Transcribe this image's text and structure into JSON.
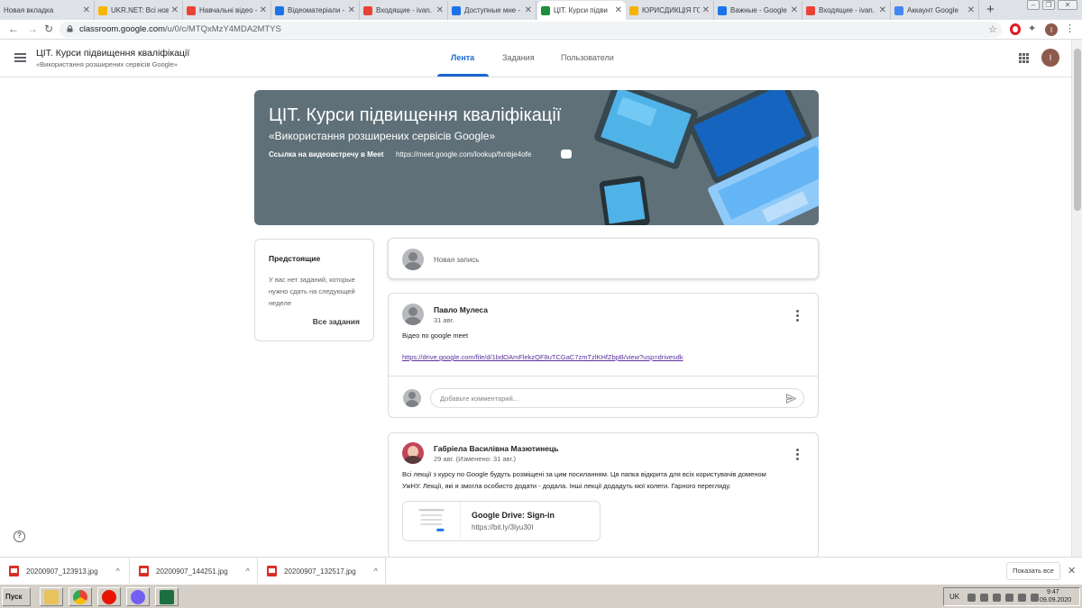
{
  "browser": {
    "tabs": [
      {
        "title": "Новая вкладка",
        "favicon": "blank-icon",
        "color": "#dee1e6"
      },
      {
        "title": "UKR.NET: Всі нови",
        "favicon": "ukrnet-icon",
        "color": "#f9b600"
      },
      {
        "title": "Навчальні відео -",
        "favicon": "gmail-icon",
        "color": "#ea4335"
      },
      {
        "title": "Відеоматеріали -",
        "favicon": "drive-icon",
        "color": "#1a73e8"
      },
      {
        "title": "Входящие - ivan.",
        "favicon": "gmail-icon",
        "color": "#ea4335"
      },
      {
        "title": "Доступные мне -",
        "favicon": "drive-icon",
        "color": "#1a73e8"
      },
      {
        "title": "ЦІТ. Курси підви",
        "favicon": "classroom-icon",
        "color": "#1e8e3e"
      },
      {
        "title": "ЮРИСДИКЦІЯ ГО",
        "favicon": "slides-icon",
        "color": "#f4b400"
      },
      {
        "title": "Важные - Google",
        "favicon": "drive-icon",
        "color": "#1a73e8"
      },
      {
        "title": "Входящие - ivan.",
        "favicon": "gmail-icon",
        "color": "#ea4335"
      },
      {
        "title": "Аккаунт Google",
        "favicon": "google-icon",
        "color": "#4285f4"
      }
    ],
    "url_host": "classroom.google.com",
    "url_path": "/u/0/c/MTQxMzY4MDA2MTYS",
    "profile_initial": "I"
  },
  "classroom": {
    "class_name": "ЦІТ. Курси підвищення кваліфікації",
    "class_subtitle": "«Використання розширених сервісів Google»",
    "nav": {
      "stream": "Лента",
      "classwork": "Задания",
      "people": "Пользователи"
    },
    "user_initial": "I"
  },
  "banner": {
    "title": "ЦІТ. Курси підвищення кваліфікації",
    "subtitle": "«Використання розширених сервісів Google»",
    "meet_label": "Ссылка на видеовстречу в Meet",
    "meet_link": "https://meet.google.com/lookup/fxnbje4ofe"
  },
  "upcoming": {
    "title": "Предстоящие",
    "empty_text": "У вас нет заданий, которые нужно сдать на следующей неделе",
    "view_all": "Все задания"
  },
  "new_post": {
    "placeholder": "Новая запись"
  },
  "posts": [
    {
      "author": "Павло Мулеса",
      "date": "31 авг.",
      "text": "Відео по google meet",
      "link": "https://drive.google.com/file/d/1bdOAmFlekzQF8uTCGaC7zmTzlKHfZbpB/view?usp=drivesdk",
      "comment_placeholder": "Добавьте комментарий..."
    },
    {
      "author": "Габріела Василівна Мазютинець",
      "date": "29 авг. (Изменено: 31 авг.)",
      "text_line1": "Всі лекції з курсу по Google будуть розміщені за цим посиланням. Ця папка відкрита для всіх користувачів доменом",
      "text_line2": "УжНУ. Лекції, які я змогла особисто додати - додала. Інші лекції додадуть мої колеги. Гарного перегляду.",
      "attachment_title": "Google Drive: Sign-in",
      "attachment_url": "https://bit.ly/3lyu30I"
    }
  ],
  "downloads": {
    "items": [
      "20200907_123913.jpg",
      "20200907_144251.jpg",
      "20200907_132517.jpg"
    ],
    "show_all": "Показать все"
  },
  "taskbar": {
    "start": "Пуск",
    "lang": "UK",
    "time": "9:47",
    "date": "09.09.2020"
  },
  "colors": {
    "accent": "#1967d2",
    "banner": "#5f7079"
  }
}
